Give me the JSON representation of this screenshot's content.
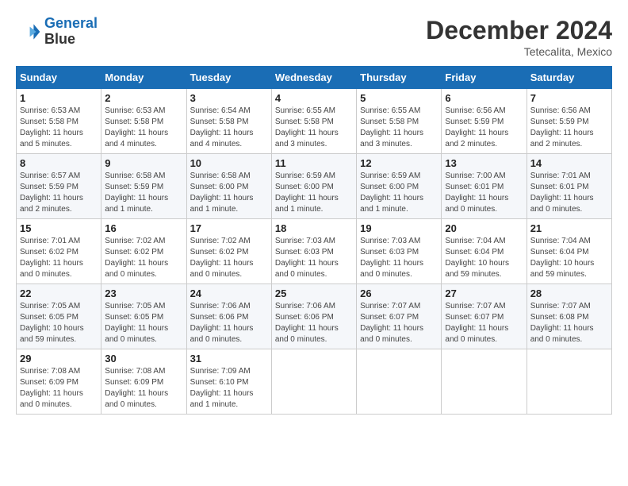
{
  "header": {
    "logo_line1": "General",
    "logo_line2": "Blue",
    "month": "December 2024",
    "location": "Tetecalita, Mexico"
  },
  "days_of_week": [
    "Sunday",
    "Monday",
    "Tuesday",
    "Wednesday",
    "Thursday",
    "Friday",
    "Saturday"
  ],
  "weeks": [
    [
      {
        "num": "1",
        "sunrise": "6:53 AM",
        "sunset": "5:58 PM",
        "daylight": "11 hours and 5 minutes."
      },
      {
        "num": "2",
        "sunrise": "6:53 AM",
        "sunset": "5:58 PM",
        "daylight": "11 hours and 4 minutes."
      },
      {
        "num": "3",
        "sunrise": "6:54 AM",
        "sunset": "5:58 PM",
        "daylight": "11 hours and 4 minutes."
      },
      {
        "num": "4",
        "sunrise": "6:55 AM",
        "sunset": "5:58 PM",
        "daylight": "11 hours and 3 minutes."
      },
      {
        "num": "5",
        "sunrise": "6:55 AM",
        "sunset": "5:58 PM",
        "daylight": "11 hours and 3 minutes."
      },
      {
        "num": "6",
        "sunrise": "6:56 AM",
        "sunset": "5:59 PM",
        "daylight": "11 hours and 2 minutes."
      },
      {
        "num": "7",
        "sunrise": "6:56 AM",
        "sunset": "5:59 PM",
        "daylight": "11 hours and 2 minutes."
      }
    ],
    [
      {
        "num": "8",
        "sunrise": "6:57 AM",
        "sunset": "5:59 PM",
        "daylight": "11 hours and 2 minutes."
      },
      {
        "num": "9",
        "sunrise": "6:58 AM",
        "sunset": "5:59 PM",
        "daylight": "11 hours and 1 minute."
      },
      {
        "num": "10",
        "sunrise": "6:58 AM",
        "sunset": "6:00 PM",
        "daylight": "11 hours and 1 minute."
      },
      {
        "num": "11",
        "sunrise": "6:59 AM",
        "sunset": "6:00 PM",
        "daylight": "11 hours and 1 minute."
      },
      {
        "num": "12",
        "sunrise": "6:59 AM",
        "sunset": "6:00 PM",
        "daylight": "11 hours and 1 minute."
      },
      {
        "num": "13",
        "sunrise": "7:00 AM",
        "sunset": "6:01 PM",
        "daylight": "11 hours and 0 minutes."
      },
      {
        "num": "14",
        "sunrise": "7:01 AM",
        "sunset": "6:01 PM",
        "daylight": "11 hours and 0 minutes."
      }
    ],
    [
      {
        "num": "15",
        "sunrise": "7:01 AM",
        "sunset": "6:02 PM",
        "daylight": "11 hours and 0 minutes."
      },
      {
        "num": "16",
        "sunrise": "7:02 AM",
        "sunset": "6:02 PM",
        "daylight": "11 hours and 0 minutes."
      },
      {
        "num": "17",
        "sunrise": "7:02 AM",
        "sunset": "6:02 PM",
        "daylight": "11 hours and 0 minutes."
      },
      {
        "num": "18",
        "sunrise": "7:03 AM",
        "sunset": "6:03 PM",
        "daylight": "11 hours and 0 minutes."
      },
      {
        "num": "19",
        "sunrise": "7:03 AM",
        "sunset": "6:03 PM",
        "daylight": "11 hours and 0 minutes."
      },
      {
        "num": "20",
        "sunrise": "7:04 AM",
        "sunset": "6:04 PM",
        "daylight": "10 hours and 59 minutes."
      },
      {
        "num": "21",
        "sunrise": "7:04 AM",
        "sunset": "6:04 PM",
        "daylight": "10 hours and 59 minutes."
      }
    ],
    [
      {
        "num": "22",
        "sunrise": "7:05 AM",
        "sunset": "6:05 PM",
        "daylight": "10 hours and 59 minutes."
      },
      {
        "num": "23",
        "sunrise": "7:05 AM",
        "sunset": "6:05 PM",
        "daylight": "11 hours and 0 minutes."
      },
      {
        "num": "24",
        "sunrise": "7:06 AM",
        "sunset": "6:06 PM",
        "daylight": "11 hours and 0 minutes."
      },
      {
        "num": "25",
        "sunrise": "7:06 AM",
        "sunset": "6:06 PM",
        "daylight": "11 hours and 0 minutes."
      },
      {
        "num": "26",
        "sunrise": "7:07 AM",
        "sunset": "6:07 PM",
        "daylight": "11 hours and 0 minutes."
      },
      {
        "num": "27",
        "sunrise": "7:07 AM",
        "sunset": "6:07 PM",
        "daylight": "11 hours and 0 minutes."
      },
      {
        "num": "28",
        "sunrise": "7:07 AM",
        "sunset": "6:08 PM",
        "daylight": "11 hours and 0 minutes."
      }
    ],
    [
      {
        "num": "29",
        "sunrise": "7:08 AM",
        "sunset": "6:09 PM",
        "daylight": "11 hours and 0 minutes."
      },
      {
        "num": "30",
        "sunrise": "7:08 AM",
        "sunset": "6:09 PM",
        "daylight": "11 hours and 0 minutes."
      },
      {
        "num": "31",
        "sunrise": "7:09 AM",
        "sunset": "6:10 PM",
        "daylight": "11 hours and 1 minute."
      },
      null,
      null,
      null,
      null
    ]
  ]
}
